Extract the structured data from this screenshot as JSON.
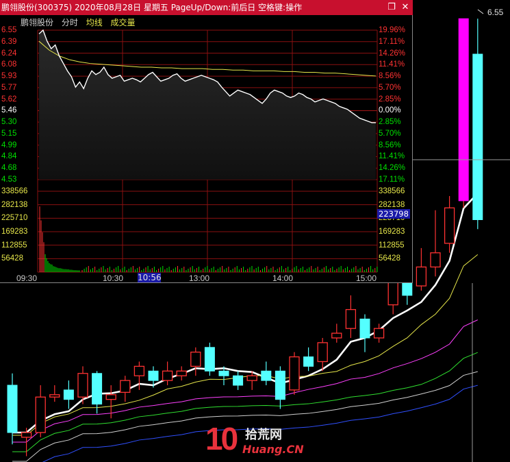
{
  "window": {
    "title": "鹏翎股份(300375)  2020年08月28日  星期五  PageUp/Down:前后日  空格键:操作",
    "restore_icon": "restore-icon",
    "close_icon": "close-icon"
  },
  "legend": {
    "stock": "鹏翎股份",
    "mode": "分时",
    "avg": "均线",
    "volume": "成交量"
  },
  "colors": {
    "up": "#ff3232",
    "down": "#00e000",
    "flat": "#ffffff",
    "avg_line": "#e6e64a",
    "grid": "#8a1010",
    "up_candle": "#ff3232",
    "down_candle": "#54ffff",
    "limit_candle": "#ff00ff"
  },
  "price_labels": [
    "6.55",
    "6.39",
    "6.24",
    "6.08",
    "5.93",
    "5.77",
    "5.62",
    "5.46",
    "5.30",
    "5.15",
    "4.99",
    "4.84",
    "4.68",
    "4.53"
  ],
  "pct_labels": [
    "19.96%",
    "17.11%",
    "14.26%",
    "11.41%",
    "8.56%",
    "5.70%",
    "2.85%",
    "0.00%",
    "2.85%",
    "5.70%",
    "8.56%",
    "11.41%",
    "14.26%",
    "17.11%"
  ],
  "vol_labels": [
    "338566",
    "282138",
    "225710",
    "169283",
    "112855",
    "56428"
  ],
  "time_labels": [
    "09:30",
    "10:30",
    "13:00",
    "14:00",
    "15:00"
  ],
  "cursor_time": "10:56",
  "current_volume": "223798",
  "kline_high_label": "6.55",
  "watermark": {
    "num": "10",
    "cn": "拾荒网",
    "en": "Huang.CN"
  },
  "chart_data": {
    "type": "line",
    "title": "鹏翎股份 分时",
    "ylim": [
      4.53,
      6.55
    ],
    "prev_close": 5.46,
    "series": [
      {
        "name": "分时",
        "values": [
          6.5,
          6.55,
          6.4,
          6.3,
          6.35,
          6.2,
          6.1,
          6.0,
          5.92,
          5.78,
          5.85,
          5.76,
          5.9,
          6.0,
          5.95,
          5.98,
          6.05,
          5.95,
          5.9,
          5.92,
          5.94,
          5.86,
          5.88,
          5.9,
          5.88,
          5.85,
          5.9,
          5.95,
          5.98,
          5.92,
          5.86,
          5.88,
          5.9,
          5.94,
          5.96,
          5.9,
          5.86,
          5.88,
          5.9,
          5.92,
          5.94,
          5.92,
          5.9,
          5.88,
          5.85,
          5.78,
          5.72,
          5.66,
          5.7,
          5.74,
          5.72,
          5.7,
          5.68,
          5.64,
          5.6,
          5.56,
          5.62,
          5.7,
          5.74,
          5.72,
          5.7,
          5.66,
          5.64,
          5.66,
          5.7,
          5.68,
          5.64,
          5.62,
          5.58,
          5.6,
          5.62,
          5.6,
          5.58,
          5.56,
          5.52,
          5.5,
          5.48,
          5.44,
          5.4,
          5.36,
          5.34,
          5.32,
          5.3,
          5.3
        ]
      },
      {
        "name": "均线",
        "values": [
          6.4,
          6.28,
          6.2,
          6.15,
          6.12,
          6.1,
          6.09,
          6.08,
          6.07,
          6.06,
          6.05,
          6.05,
          6.04,
          6.04,
          6.03,
          6.03,
          6.03,
          6.02,
          6.02,
          6.01,
          6.01,
          6.0,
          6.0,
          6.0,
          5.99,
          5.99,
          5.98,
          5.98,
          5.97,
          5.97,
          5.96,
          5.95,
          5.94,
          5.93
        ]
      }
    ],
    "volume": [
      330000,
      260000,
      200000,
      150000,
      90000,
      70000,
      55000,
      45000,
      40000,
      38000,
      30000,
      28000,
      25000,
      22000,
      20000,
      20000,
      18000,
      16000,
      15000,
      15000,
      14000,
      14000,
      12000,
      12000,
      11000,
      10000,
      10000,
      9500,
      9000,
      9000
    ]
  },
  "kline_data": {
    "candles": [
      {
        "o": 5.0,
        "c": 4.8,
        "h": 5.05,
        "l": 4.75
      },
      {
        "o": 4.78,
        "c": 4.8,
        "h": 4.82,
        "l": 4.7
      },
      {
        "o": 4.8,
        "c": 4.95,
        "h": 5.0,
        "l": 4.78
      },
      {
        "o": 4.95,
        "c": 4.96,
        "h": 5.0,
        "l": 4.93
      },
      {
        "o": 4.98,
        "c": 4.94,
        "h": 5.02,
        "l": 4.9
      },
      {
        "o": 4.95,
        "c": 5.05,
        "h": 5.08,
        "l": 4.92
      },
      {
        "o": 5.05,
        "c": 4.92,
        "h": 5.06,
        "l": 4.88
      },
      {
        "o": 4.94,
        "c": 4.96,
        "h": 5.0,
        "l": 4.86
      },
      {
        "o": 4.97,
        "c": 5.02,
        "h": 5.04,
        "l": 4.93
      },
      {
        "o": 5.04,
        "c": 5.08,
        "h": 5.1,
        "l": 4.98
      },
      {
        "o": 5.06,
        "c": 5.02,
        "h": 5.08,
        "l": 4.99
      },
      {
        "o": 5.02,
        "c": 5.06,
        "h": 5.1,
        "l": 5.0
      },
      {
        "o": 5.04,
        "c": 5.06,
        "h": 5.08,
        "l": 5.02
      },
      {
        "o": 5.08,
        "c": 5.14,
        "h": 5.16,
        "l": 5.04
      },
      {
        "o": 5.16,
        "c": 5.06,
        "h": 5.18,
        "l": 5.04
      },
      {
        "o": 5.06,
        "c": 5.04,
        "h": 5.08,
        "l": 5.0
      },
      {
        "o": 5.04,
        "c": 5.0,
        "h": 5.06,
        "l": 4.98
      },
      {
        "o": 5.02,
        "c": 5.04,
        "h": 5.06,
        "l": 4.98
      },
      {
        "o": 5.06,
        "c": 5.02,
        "h": 5.1,
        "l": 5.0
      },
      {
        "o": 5.06,
        "c": 4.94,
        "h": 5.08,
        "l": 4.9
      },
      {
        "o": 4.98,
        "c": 5.12,
        "h": 5.14,
        "l": 4.96
      },
      {
        "o": 5.12,
        "c": 5.08,
        "h": 5.16,
        "l": 5.06
      },
      {
        "o": 5.1,
        "c": 5.18,
        "h": 5.2,
        "l": 5.06
      },
      {
        "o": 5.2,
        "c": 5.22,
        "h": 5.26,
        "l": 5.18
      },
      {
        "o": 5.24,
        "c": 5.32,
        "h": 5.38,
        "l": 5.2
      },
      {
        "o": 5.28,
        "c": 5.2,
        "h": 5.3,
        "l": 5.14
      },
      {
        "o": 5.2,
        "c": 5.24,
        "h": 5.26,
        "l": 5.18
      },
      {
        "o": 5.34,
        "c": 5.44,
        "h": 5.6,
        "l": 5.3
      },
      {
        "o": 5.46,
        "c": 5.38,
        "h": 5.5,
        "l": 5.34
      },
      {
        "o": 5.42,
        "c": 5.5,
        "h": 5.58,
        "l": 5.4
      },
      {
        "o": 5.5,
        "c": 5.56,
        "h": 5.74,
        "l": 5.46
      },
      {
        "o": 5.6,
        "c": 5.75,
        "h": 5.8,
        "l": 5.56
      },
      {
        "o": 5.78,
        "c": 6.55,
        "h": 6.55,
        "l": 5.75
      },
      {
        "o": 6.4,
        "c": 5.7,
        "h": 6.55,
        "l": 5.66
      }
    ]
  }
}
